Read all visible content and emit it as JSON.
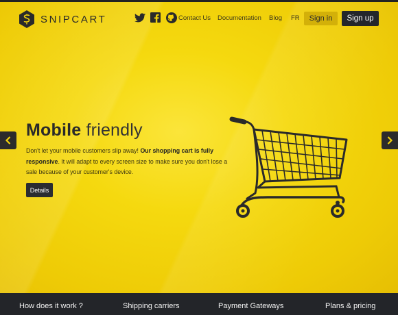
{
  "brand": {
    "name": "SNIPCART"
  },
  "social": [
    {
      "name": "twitter",
      "icon": "twitter-icon"
    },
    {
      "name": "facebook",
      "icon": "facebook-icon"
    },
    {
      "name": "github",
      "icon": "github-icon"
    }
  ],
  "nav": {
    "contact": "Contact Us",
    "documentation": "Documentation",
    "blog": "Blog",
    "lang": "FR",
    "signin": "Sign in",
    "signup": "Sign up"
  },
  "slide": {
    "headline_bold": "Mobile",
    "headline_light": "friendly",
    "desc_part1": "Don't let your mobile customers slip away! ",
    "desc_bold": "Our shopping cart is fully responsive",
    "desc_part2": ". It will adapt to every screen size to make sure you don't lose a sale because of your customer's device.",
    "details_label": "Details",
    "image": "shopping-cart-icon"
  },
  "carousel": {
    "prev_icon": "chevron-left-icon",
    "next_icon": "chevron-right-icon"
  },
  "footer": {
    "items": [
      "How does it work ?",
      "Shipping carriers",
      "Payment Gateways",
      "Plans & pricing"
    ]
  },
  "colors": {
    "background": "#f2d20a",
    "dark": "#232529",
    "signin_bg": "#d3b009"
  }
}
